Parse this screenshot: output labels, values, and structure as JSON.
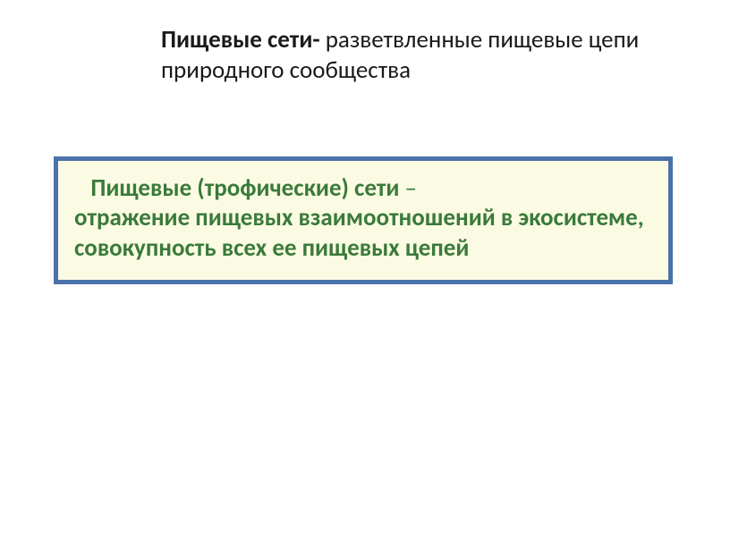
{
  "heading": {
    "bold": "Пищевые сети-",
    "rest": " разветвленные пищевые цепи природного сообщества"
  },
  "definition": {
    "title": "Пищевые (трофические) сети",
    "dash": " – ",
    "body": "отражение пищевых взаимоотношений в экосистеме, совокупность всех ее пищевых цепей"
  }
}
